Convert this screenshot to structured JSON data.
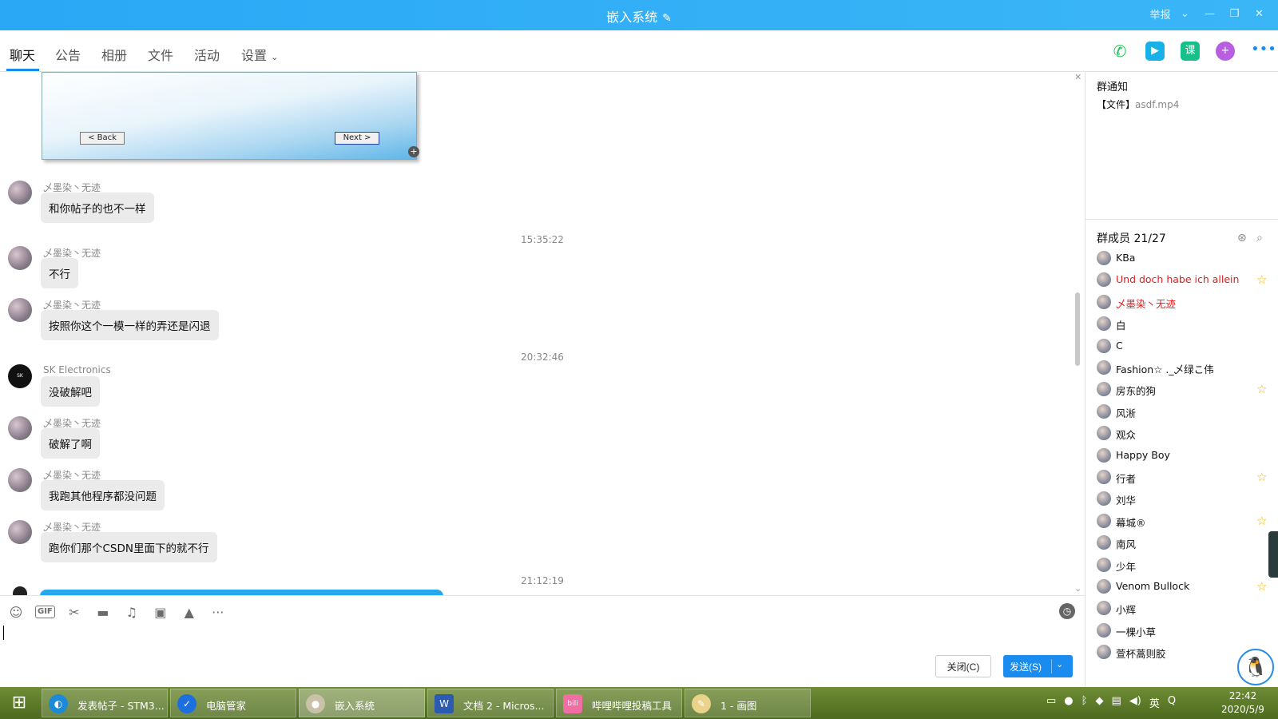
{
  "window": {
    "title": "嵌入系统",
    "report_label": "举报",
    "controls": [
      "⌄",
      "—",
      "❐",
      "✕"
    ]
  },
  "tabs": [
    {
      "label": "聊天"
    },
    {
      "label": "公告"
    },
    {
      "label": "相册"
    },
    {
      "label": "文件"
    },
    {
      "label": "活动"
    },
    {
      "label": "设置"
    }
  ],
  "top_actions": {
    "course_label": "课"
  },
  "screenshot_dialog": {
    "back_label": "< Back",
    "next_label": "Next >"
  },
  "messages": [
    {
      "sender": "乄墨染丶无迹",
      "text": "和你帖子的也不一样"
    },
    {
      "time": "15:35:22"
    },
    {
      "sender": "乄墨染丶无迹",
      "text": "不行"
    },
    {
      "sender": "乄墨染丶无迹",
      "text": "按照你这个一模一样的弄还是闪退"
    },
    {
      "time": "20:32:46"
    },
    {
      "sender": "SK Electronics",
      "text": "没破解吧"
    },
    {
      "sender": "乄墨染丶无迹",
      "text": "破解了啊"
    },
    {
      "sender": "乄墨染丶无迹",
      "text": "我跑其他程序都没问题"
    },
    {
      "sender": "乄墨染丶无迹",
      "text": "跑你们那个CSDN里面下的就不行"
    },
    {
      "time": "21:12:19"
    }
  ],
  "input": {
    "close_label": "关闭(C)",
    "send_label": "发送(S)",
    "gif_label": "GIF"
  },
  "notice": {
    "title": "群通知",
    "file_prefix": "【文件】",
    "file_name": "asdf.mp4"
  },
  "members": {
    "title": "群成员 21/27",
    "list": [
      {
        "name": "KBa",
        "red": false,
        "star": false
      },
      {
        "name": "Und doch habe ich allein",
        "red": true,
        "star": true
      },
      {
        "name": "乄墨染丶无迹",
        "red": true,
        "star": false
      },
      {
        "name": "白",
        "red": false,
        "star": false
      },
      {
        "name": "C",
        "red": false,
        "star": false
      },
      {
        "name": "Fashion☆ ._乄绿こ伟",
        "red": false,
        "star": false
      },
      {
        "name": "房东的狗",
        "red": false,
        "star": true
      },
      {
        "name": "风淅",
        "red": false,
        "star": false
      },
      {
        "name": "观众",
        "red": false,
        "star": false
      },
      {
        "name": "Happy Boy",
        "red": false,
        "star": false
      },
      {
        "name": "行者",
        "red": false,
        "star": true
      },
      {
        "name": "刘华",
        "red": false,
        "star": false
      },
      {
        "name": "幕城®",
        "red": false,
        "star": true
      },
      {
        "name": "南风",
        "red": false,
        "star": false
      },
      {
        "name": "少年",
        "red": false,
        "star": false
      },
      {
        "name": "Venom Bullock",
        "red": false,
        "star": true
      },
      {
        "name": "小辉",
        "red": false,
        "star": false
      },
      {
        "name": "一棵小草",
        "red": false,
        "star": false
      },
      {
        "name": "萱杯蒿则胶",
        "red": false,
        "star": false
      }
    ]
  },
  "taskbar": {
    "tasks": [
      {
        "label": "发表帖子 - STM3..."
      },
      {
        "label": "电脑管家"
      },
      {
        "label": "嵌入系统"
      },
      {
        "label": "文档 2 - Micros..."
      },
      {
        "label": "哔哩哔哩投稿工具"
      },
      {
        "label": "1 - 画图"
      }
    ],
    "ime_label": "英",
    "time": "22:42",
    "date": "2020/5/9"
  },
  "colors": {
    "accent": "#1a8cf0",
    "titlebar": "#2aa8f5",
    "admin_red": "#e51c1c",
    "star": "#f5b400"
  }
}
